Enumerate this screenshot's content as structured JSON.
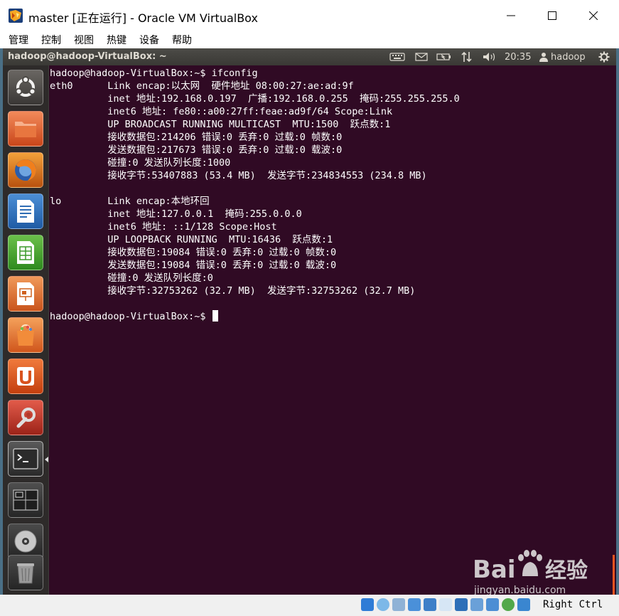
{
  "window": {
    "title": "master [正在运行] - Oracle VM VirtualBox",
    "controls": [
      "minimize",
      "maximize",
      "close"
    ]
  },
  "menubar": {
    "items": [
      {
        "label": "管理"
      },
      {
        "label": "控制"
      },
      {
        "label": "视图"
      },
      {
        "label": "热键"
      },
      {
        "label": "设备"
      },
      {
        "label": "帮助"
      }
    ]
  },
  "panel": {
    "window_title": "hadoop@hadoop-VirtualBox: ~",
    "indicators": [
      "keyboard-icon",
      "mail-icon",
      "battery-icon",
      "network-icon",
      "volume-icon"
    ],
    "clock": "20:35",
    "user": "hadoop"
  },
  "launcher": {
    "items": [
      {
        "name": "dash-home",
        "icon": "ubuntu-logo-icon"
      },
      {
        "name": "home-folder",
        "icon": "folder-icon"
      },
      {
        "name": "firefox",
        "icon": "firefox-icon"
      },
      {
        "name": "libreoffice-writer",
        "icon": "writer-icon"
      },
      {
        "name": "libreoffice-calc",
        "icon": "calc-icon"
      },
      {
        "name": "libreoffice-impress",
        "icon": "impress-icon"
      },
      {
        "name": "software-center",
        "icon": "shopping-bag-icon"
      },
      {
        "name": "ubuntu-one",
        "icon": "ubuntu-one-icon"
      },
      {
        "name": "system-settings",
        "icon": "settings-wrench-icon"
      },
      {
        "name": "terminal",
        "icon": "terminal-icon"
      },
      {
        "name": "workspace-switcher",
        "icon": "workspaces-icon"
      },
      {
        "name": "dvd-drive",
        "icon": "disc-icon"
      },
      {
        "name": "trash",
        "icon": "trash-icon"
      }
    ]
  },
  "terminal": {
    "lines": [
      "hadoop@hadoop-VirtualBox:~$ ifconfig",
      "eth0      Link encap:以太网  硬件地址 08:00:27:ae:ad:9f",
      "          inet 地址:192.168.0.197  广播:192.168.0.255  掩码:255.255.255.0",
      "          inet6 地址: fe80::a00:27ff:feae:ad9f/64 Scope:Link",
      "          UP BROADCAST RUNNING MULTICAST  MTU:1500  跃点数:1",
      "          接收数据包:214206 错误:0 丢弃:0 过载:0 帧数:0",
      "          发送数据包:217673 错误:0 丢弃:0 过载:0 载波:0",
      "          碰撞:0 发送队列长度:1000",
      "          接收字节:53407883 (53.4 MB)  发送字节:234834553 (234.8 MB)",
      "",
      "lo        Link encap:本地环回",
      "          inet 地址:127.0.0.1  掩码:255.0.0.0",
      "          inet6 地址: ::1/128 Scope:Host",
      "          UP LOOPBACK RUNNING  MTU:16436  跃点数:1",
      "          接收数据包:19084 错误:0 丢弃:0 过载:0 帧数:0",
      "          发送数据包:19084 错误:0 丢弃:0 过载:0 载波:0",
      "          碰撞:0 发送队列长度:0",
      "          接收字节:32753262 (32.7 MB)  发送字节:32753262 (32.7 MB)",
      "",
      "hadoop@hadoop-VirtualBox:~$ "
    ]
  },
  "statusbar": {
    "host_key": "Right Ctrl"
  },
  "watermark": {
    "brand": "Baidu经验",
    "url": "jingyan.baidu.com"
  },
  "colors": {
    "terminal_bg": "#300a24",
    "terminal_fg": "#ffffff",
    "panel_bg": "#3c3b37",
    "launcher_bg": "#2e2b2a",
    "ubuntu_orange": "#e95420"
  }
}
